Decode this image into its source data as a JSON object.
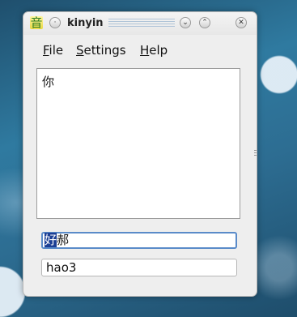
{
  "window": {
    "app_icon_glyph": "音",
    "title": "kinyin",
    "buttons": {
      "menu_glyph": "·",
      "minimize_glyph": "⌄",
      "maximize_glyph": "⌃",
      "close_glyph": "✕"
    }
  },
  "menu": {
    "file": {
      "mnemonic": "F",
      "rest": "ile"
    },
    "settings": {
      "mnemonic": "S",
      "rest": "ettings"
    },
    "help": {
      "mnemonic": "H",
      "rest": "elp"
    }
  },
  "editor": {
    "text": "你"
  },
  "candidate": {
    "selected": "好",
    "rest": "郝"
  },
  "pinyin_input": {
    "value": "hao3"
  },
  "colors": {
    "selection": "#1c3f94",
    "focus_border": "#5a8bc9"
  }
}
